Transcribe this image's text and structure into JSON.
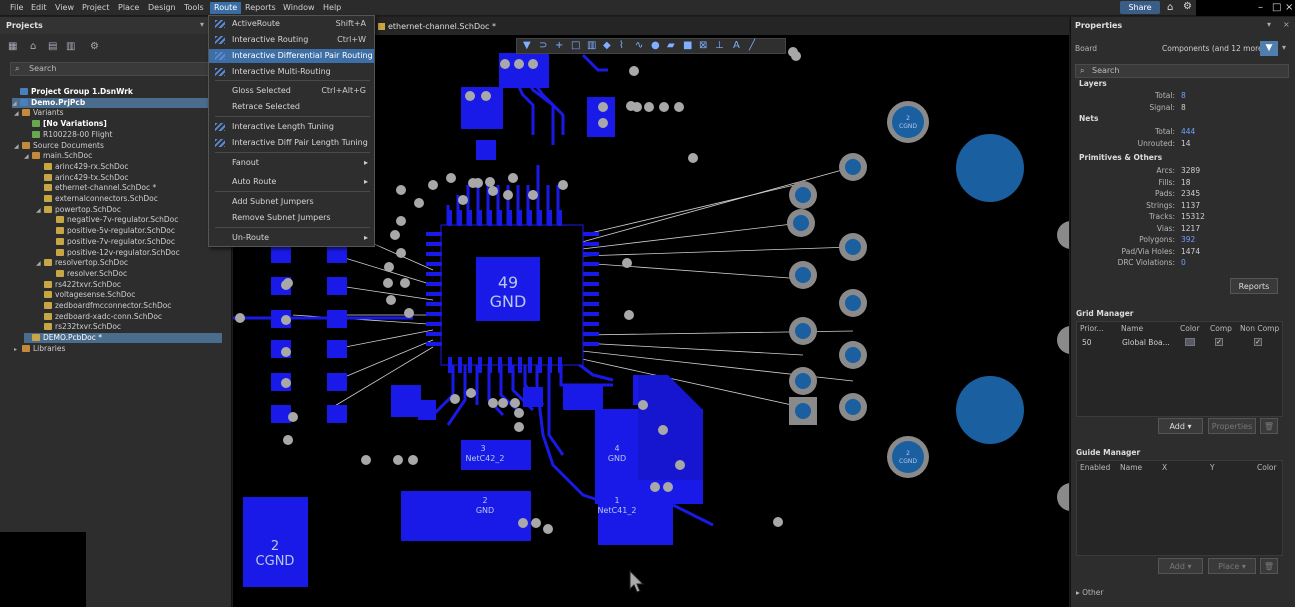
{
  "menubar": {
    "items": [
      "File",
      "Edit",
      "View",
      "Project",
      "Place",
      "Design",
      "Tools",
      "Route",
      "Reports",
      "Window",
      "Help"
    ],
    "share_label": "Share"
  },
  "projects": {
    "title": "Projects",
    "search_placeholder": "Search",
    "tree": [
      {
        "label": "Project Group 1.DsnWrk",
        "level": 0
      },
      {
        "label": "Demo.PrjPcb",
        "level": 0
      },
      {
        "label": "Variants",
        "level": 1
      },
      {
        "label": "[No Variations]",
        "level": 2
      },
      {
        "label": "R100228-00 Flight",
        "level": 2
      },
      {
        "label": "Source Documents",
        "level": 1
      },
      {
        "label": "main.SchDoc",
        "level": 2
      },
      {
        "label": "arinc429-rx.SchDoc",
        "level": 3
      },
      {
        "label": "arinc429-tx.SchDoc",
        "level": 3
      },
      {
        "label": "ethernet-channel.SchDoc *",
        "level": 3
      },
      {
        "label": "externalconnectors.SchDoc",
        "level": 3
      },
      {
        "label": "powertop.SchDoc",
        "level": 3
      },
      {
        "label": "negative-7v-regulator.SchDoc",
        "level": 4
      },
      {
        "label": "positive-5v-regulator.SchDoc",
        "level": 4
      },
      {
        "label": "positive-7v-regulator.SchDoc",
        "level": 4
      },
      {
        "label": "positive-12v-regulator.SchDoc",
        "level": 4
      },
      {
        "label": "resolvertop.SchDoc",
        "level": 3
      },
      {
        "label": "resolver.SchDoc",
        "level": 4
      },
      {
        "label": "rs422txvr.SchDoc",
        "level": 3
      },
      {
        "label": "voltagesense.SchDoc",
        "level": 3
      },
      {
        "label": "zedboardfmcconnector.SchDoc",
        "level": 3
      },
      {
        "label": "zedboard-xadc-conn.SchDoc",
        "level": 3
      },
      {
        "label": "rs232txvr.SchDoc",
        "level": 3
      },
      {
        "label": "DEMO.PcbDoc *",
        "level": 2
      },
      {
        "label": "Libraries",
        "level": 1
      }
    ]
  },
  "doc_tab": "ethernet-channel.SchDoc *",
  "route_menu": {
    "items": [
      {
        "label": "ActiveRoute",
        "shortcut": "Shift+A"
      },
      {
        "label": "Interactive Routing",
        "shortcut": "Ctrl+W"
      },
      {
        "label": "Interactive Differential Pair Routing",
        "shortcut": ""
      },
      {
        "label": "Interactive Multi-Routing",
        "shortcut": ""
      },
      {
        "label": "Gloss Selected",
        "shortcut": "Ctrl+Alt+G"
      },
      {
        "label": "Retrace Selected",
        "shortcut": ""
      },
      {
        "label": "Interactive Length Tuning",
        "shortcut": ""
      },
      {
        "label": "Interactive Diff Pair Length Tuning",
        "shortcut": ""
      },
      {
        "label": "Fanout",
        "shortcut": ""
      },
      {
        "label": "Auto Route",
        "shortcut": ""
      },
      {
        "label": "Add Subnet Jumpers",
        "shortcut": ""
      },
      {
        "label": "Remove Subnet Jumpers",
        "shortcut": ""
      },
      {
        "label": "Un-Route",
        "shortcut": ""
      }
    ],
    "highlighted": "Interactive Differential Pair Routing"
  },
  "pcb": {
    "labels": {
      "gnd49_num": "49",
      "gnd49_net": "GND",
      "netc42_num": "3",
      "netc42_net": "NetC42_2",
      "gnd4_num": "4",
      "gnd4_net": "GND",
      "gnd2_num": "2",
      "gnd2_net": "GND",
      "netc41_num": "1",
      "netc41_net": "NetC41_2",
      "cgnd2_num": "2",
      "cgnd2_net": "CGND",
      "cgnd_top_num": "2",
      "cgnd_top_net": "CGND",
      "cgnd_bot_num": "2",
      "cgnd_bot_net": "CGND"
    }
  },
  "properties": {
    "title": "Properties",
    "scope": "Board",
    "filter_text": "Components (and 12 more)",
    "search_placeholder": "Search",
    "layers": {
      "title": "Layers",
      "total_label": "Total:",
      "total": "8",
      "signal_label": "Signal:",
      "signal": "8"
    },
    "nets": {
      "title": "Nets",
      "total_label": "Total:",
      "total": "444",
      "unrouted_label": "Unrouted:",
      "unrouted": "14"
    },
    "primitives": {
      "title": "Primitives & Others",
      "rows": [
        {
          "label": "Arcs:",
          "value": "3289"
        },
        {
          "label": "Fills:",
          "value": "18"
        },
        {
          "label": "Pads:",
          "value": "2345"
        },
        {
          "label": "Strings:",
          "value": "1137"
        },
        {
          "label": "Tracks:",
          "value": "15312"
        },
        {
          "label": "Vias:",
          "value": "1217"
        },
        {
          "label": "Polygons:",
          "value": "392"
        },
        {
          "label": "Pad/Via Holes:",
          "value": "1474"
        },
        {
          "label": "DRC Violations:",
          "value": "0"
        }
      ]
    },
    "reports_label": "Reports",
    "grid_manager": {
      "title": "Grid Manager",
      "columns": [
        "Prior...",
        "Name",
        "Color",
        "Comp",
        "Non Comp"
      ],
      "row": {
        "priority": "50",
        "name": "Global Boa..."
      },
      "add_label": "Add",
      "properties_label": "Properties"
    },
    "guide_manager": {
      "title": "Guide Manager",
      "columns": [
        "Enabled",
        "Name",
        "X",
        "Y",
        "Color"
      ],
      "add_label": "Add",
      "place_label": "Place"
    },
    "other_label": "Other"
  }
}
